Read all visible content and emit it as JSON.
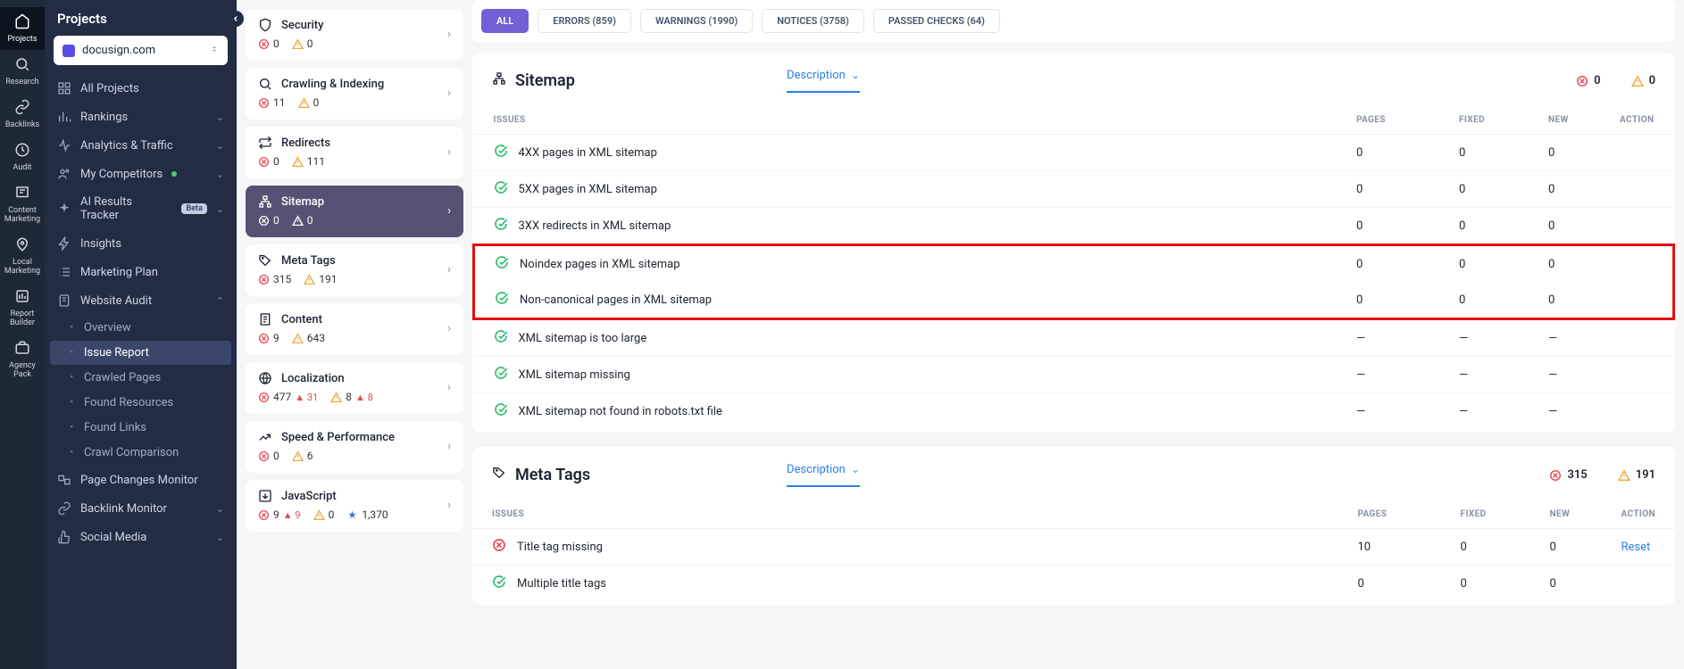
{
  "rail": [
    {
      "label": "Projects",
      "active": true
    },
    {
      "label": "Research"
    },
    {
      "label": "Backlinks"
    },
    {
      "label": "Audit"
    },
    {
      "label": "Content Marketing"
    },
    {
      "label": "Local Marketing"
    },
    {
      "label": "Report Builder"
    },
    {
      "label": "Agency Pack"
    }
  ],
  "side": {
    "title": "Projects",
    "domain": "docusign.com",
    "nav": [
      {
        "label": "All Projects",
        "ico": "grid"
      },
      {
        "label": "Rankings",
        "ico": "bars",
        "chev": true
      },
      {
        "label": "Analytics & Traffic",
        "ico": "pulse",
        "chev": true
      },
      {
        "label": "My Competitors",
        "ico": "people",
        "dot": true,
        "chev": true
      },
      {
        "label": "AI Results Tracker",
        "ico": "sparkle",
        "beta": true,
        "chev": true
      },
      {
        "label": "Insights",
        "ico": "bolt"
      },
      {
        "label": "Marketing Plan",
        "ico": "list"
      },
      {
        "label": "Website Audit",
        "ico": "doc",
        "open": true,
        "sub": [
          {
            "label": "Overview"
          },
          {
            "label": "Issue Report",
            "active": true
          },
          {
            "label": "Crawled Pages"
          },
          {
            "label": "Found Resources"
          },
          {
            "label": "Found Links"
          },
          {
            "label": "Crawl Comparison"
          }
        ]
      },
      {
        "label": "Page Changes Monitor",
        "ico": "layers"
      },
      {
        "label": "Backlink Monitor",
        "ico": "link",
        "chev": true
      },
      {
        "label": "Social Media",
        "ico": "thumb",
        "chev": true
      }
    ]
  },
  "filters": [
    {
      "label": "ALL",
      "active": true
    },
    {
      "label": "ERRORS (859)"
    },
    {
      "label": "WARNINGS (1990)"
    },
    {
      "label": "NOTICES (3758)"
    },
    {
      "label": "PASSED CHECKS (64)"
    }
  ],
  "categories": [
    {
      "title": "Security",
      "ico": "shield",
      "err": "0",
      "warn": "0"
    },
    {
      "title": "Crawling & Indexing",
      "ico": "search",
      "err": "11",
      "warn": "0"
    },
    {
      "title": "Redirects",
      "ico": "redir",
      "err": "0",
      "warn": "111"
    },
    {
      "title": "Sitemap",
      "ico": "sitemap",
      "err": "0",
      "warn": "0",
      "active": true
    },
    {
      "title": "Meta Tags",
      "ico": "tag",
      "err": "315",
      "warn": "191"
    },
    {
      "title": "Content",
      "ico": "page",
      "err": "9",
      "warn": "643"
    },
    {
      "title": "Localization",
      "ico": "globe",
      "err": "477",
      "errD": "▲ 31",
      "warn": "8",
      "warnD": "▲ 8"
    },
    {
      "title": "Speed & Performance",
      "ico": "trend",
      "err": "0",
      "warn": "6"
    },
    {
      "title": "JavaScript",
      "ico": "js",
      "err": "9",
      "errD": "▲ 9",
      "warn": "0",
      "note": "1,370"
    }
  ],
  "table": {
    "headers": {
      "issues": "ISSUES",
      "pages": "PAGES",
      "fixed": "FIXED",
      "new": "NEW",
      "action": "ACTION"
    }
  },
  "sections": [
    {
      "title": "Sitemap",
      "ico": "sitemap",
      "dropdown": "Description",
      "stat_err": "0",
      "stat_warn": "0",
      "rows": [
        {
          "name": "4XX pages in XML sitemap",
          "status": "ok",
          "pages": "0",
          "fixed": "0",
          "new": "0"
        },
        {
          "name": "5XX pages in XML sitemap",
          "status": "ok",
          "pages": "0",
          "fixed": "0",
          "new": "0"
        },
        {
          "name": "3XX redirects in XML sitemap",
          "status": "ok",
          "pages": "0",
          "fixed": "0",
          "new": "0"
        },
        {
          "name": "Noindex pages in XML sitemap",
          "status": "ok",
          "pages": "0",
          "fixed": "0",
          "new": "0",
          "hl": true
        },
        {
          "name": "Non-canonical pages in XML sitemap",
          "status": "ok",
          "pages": "0",
          "fixed": "0",
          "new": "0",
          "hl": true
        },
        {
          "name": "XML sitemap is too large",
          "status": "ok",
          "pages": "—",
          "fixed": "—",
          "new": "—"
        },
        {
          "name": "XML sitemap missing",
          "status": "ok",
          "pages": "—",
          "fixed": "—",
          "new": "—"
        },
        {
          "name": "XML sitemap not found in robots.txt file",
          "status": "ok",
          "pages": "—",
          "fixed": "—",
          "new": "—"
        }
      ]
    },
    {
      "title": "Meta Tags",
      "ico": "tag",
      "dropdown": "Description",
      "stat_err": "315",
      "stat_warn": "191",
      "rows": [
        {
          "name": "Title tag missing",
          "status": "err",
          "pages": "10",
          "fixed": "0",
          "new": "0",
          "action": "Reset"
        },
        {
          "name": "Multiple title tags",
          "status": "ok",
          "pages": "0",
          "fixed": "0",
          "new": "0"
        }
      ]
    }
  ]
}
